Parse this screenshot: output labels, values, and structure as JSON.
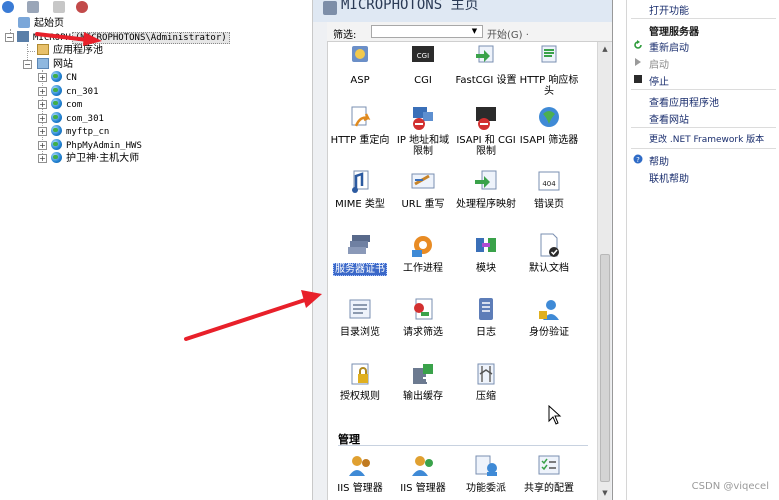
{
  "tree": {
    "start_page": "起始页",
    "server_prefix": "MICROPH",
    "server_account": "(MICROPHOTONS\\Administrator)",
    "app_pools": "应用程序池",
    "sites": "网站",
    "site_list": [
      "CN",
      "cn_301",
      "com",
      "com_301",
      "myftp_cn",
      "PhpMyAdmin_HWS",
      "护卫神·主机大师"
    ]
  },
  "center": {
    "title": "MICROPHOTONS 主页",
    "filter_label": "筛选:",
    "filter_value": "",
    "start_label": "开始(G) ·",
    "features": [
      {
        "label": "ASP",
        "icon": "asp-icon"
      },
      {
        "label": "CGI",
        "icon": "cgi-icon"
      },
      {
        "label": "FastCGI 设置",
        "icon": "fastcgi-icon"
      },
      {
        "label": "HTTP 响应标头",
        "icon": "http-headers-icon"
      },
      {
        "label": "HTTP 重定向",
        "icon": "http-redirect-icon"
      },
      {
        "label": "IP 地址和域限制",
        "icon": "ip-restrict-icon"
      },
      {
        "label": "ISAPI 和 CGI 限制",
        "icon": "isapi-cgi-icon"
      },
      {
        "label": "ISAPI 筛选器",
        "icon": "isapi-filter-icon"
      },
      {
        "label": "MIME 类型",
        "icon": "mime-icon"
      },
      {
        "label": "URL 重写",
        "icon": "url-rewrite-icon"
      },
      {
        "label": "处理程序映射",
        "icon": "handler-icon"
      },
      {
        "label": "错误页",
        "icon": "error-page-icon"
      },
      {
        "label": "服务器证书",
        "icon": "server-cert-icon"
      },
      {
        "label": "工作进程",
        "icon": "worker-process-icon"
      },
      {
        "label": "模块",
        "icon": "modules-icon"
      },
      {
        "label": "默认文档",
        "icon": "default-doc-icon"
      },
      {
        "label": "目录浏览",
        "icon": "dir-browse-icon"
      },
      {
        "label": "请求筛选",
        "icon": "request-filter-icon"
      },
      {
        "label": "日志",
        "icon": "logging-icon"
      },
      {
        "label": "身份验证",
        "icon": "auth-icon"
      },
      {
        "label": "授权规则",
        "icon": "authz-icon"
      },
      {
        "label": "输出缓存",
        "icon": "output-cache-icon"
      },
      {
        "label": "压缩",
        "icon": "compression-icon"
      }
    ],
    "group_manage": "管理",
    "manage_features": [
      {
        "label": "IIS 管理器",
        "icon": "iis-manager-icon"
      },
      {
        "label": "IIS 管理器",
        "icon": "iis-manager-perm-icon"
      },
      {
        "label": "功能委派",
        "icon": "feature-delegation-icon"
      },
      {
        "label": "共享的配置",
        "icon": "shared-config-icon"
      }
    ]
  },
  "actions": {
    "open_feature": "打开功能",
    "manage_server": "管理服务器",
    "restart": "重新启动",
    "start": "启动",
    "stop": "停止",
    "view_pools": "查看应用程序池",
    "view_sites": "查看网站",
    "change_net": "更改 .NET Framework 版本",
    "help": "帮助",
    "online_help": "联机帮助"
  },
  "watermark": "CSDN @viqecel",
  "colors": {
    "selection": "#3b68c8",
    "arrow": "#e8202a",
    "link": "#1a2e6e"
  }
}
